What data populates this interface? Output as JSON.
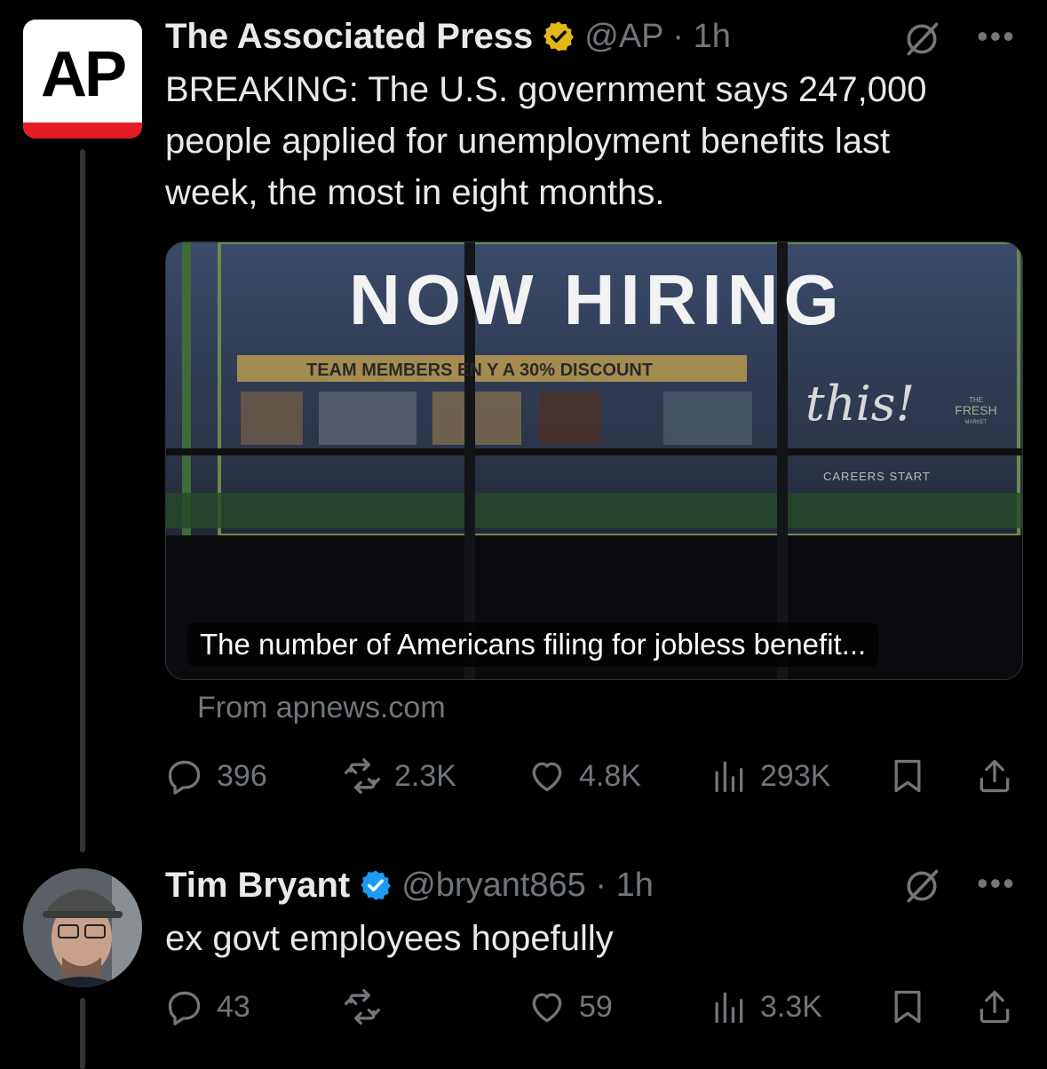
{
  "colors": {
    "background": "#000000",
    "text": "#e7e9ea",
    "muted": "#71767b",
    "verified_gold": "#e2b719",
    "verified_blue": "#1d9bf0",
    "ap_red": "#e51b23"
  },
  "tweet": {
    "avatar_text": "AP",
    "author_name": "The Associated Press",
    "handle_time": "@AP · 1h",
    "text_lines": [
      "BREAKING: The U.S. government says 247,000",
      "people applied for unemployment benefits last",
      "week, the most in eight months."
    ],
    "card": {
      "image_headline": "NOW HIRING",
      "image_banner": "TEAM MEMBERS EN  Y A 30% DISCOUNT",
      "image_script": "this!",
      "image_logo_line1": "THE",
      "image_logo_line2": "FRESH",
      "image_logo_line3": "MARKET",
      "image_careers": "CAREERS START",
      "caption": "The number of Americans filing for jobless benefit..."
    },
    "source": "From apnews.com",
    "actions": {
      "replies": "396",
      "reposts": "2.3K",
      "likes": "4.8K",
      "views": "293K"
    }
  },
  "reply": {
    "author_name": "Tim Bryant",
    "handle_time": "@bryant865 · 1h",
    "text": "ex govt employees hopefully",
    "actions": {
      "replies": "43",
      "reposts": "",
      "likes": "59",
      "views": "3.3K"
    }
  },
  "icons": [
    "verified-gold-badge",
    "verified-blue-badge",
    "grok-icon",
    "more-icon",
    "reply-icon",
    "repost-icon",
    "like-icon",
    "views-icon",
    "bookmark-icon",
    "share-icon"
  ]
}
